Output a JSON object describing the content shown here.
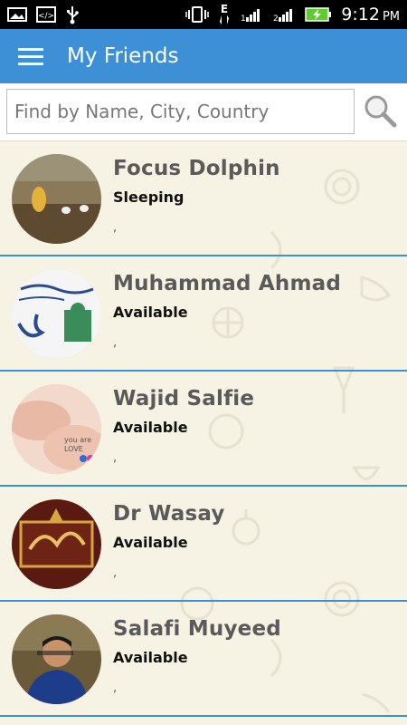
{
  "status_bar": {
    "time": "9:12",
    "ampm": "PM",
    "icons": [
      "image-icon",
      "code-icon",
      "usb-icon",
      "vibrate-icon",
      "data-e-icon",
      "signal-icon",
      "signal-2-icon",
      "battery-charging-icon"
    ]
  },
  "app_bar": {
    "title": "My Friends",
    "menu_icon": "menu-icon"
  },
  "search": {
    "placeholder": "Find by Name, City, Country",
    "value": "",
    "button_icon": "search-icon"
  },
  "friends": [
    {
      "name": "Focus Dolphin",
      "status": "Sleeping",
      "extra": ","
    },
    {
      "name": "Muhammad Ahmad",
      "status": "Available",
      "extra": ","
    },
    {
      "name": "Wajid Salfie",
      "status": "Available",
      "extra": ","
    },
    {
      "name": "Dr Wasay",
      "status": "Available",
      "extra": ","
    },
    {
      "name": "Salafi Muyeed",
      "status": "Available",
      "extra": ","
    }
  ],
  "colors": {
    "accent": "#3d8fd6",
    "background": "#f6f3e4",
    "status_bar": "#000000",
    "battery": "#5fcc2e"
  }
}
